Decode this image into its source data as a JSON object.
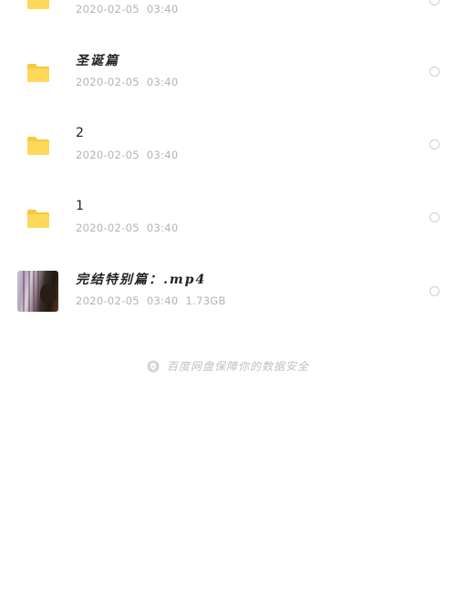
{
  "colors": {
    "folder": "#FDD85B",
    "folder_tab": "#F8C93C",
    "name_text": "#222222",
    "meta_text": "#B3B3B3",
    "radio_border": "#CFCFCF",
    "footer_text": "#C0C0C0"
  },
  "files": [
    {
      "type": "folder",
      "icon": "folder-icon",
      "name": "",
      "date": "2020-02-05",
      "time": "03:40",
      "size": ""
    },
    {
      "type": "folder",
      "icon": "folder-icon",
      "name": "圣诞篇",
      "date": "2020-02-05",
      "time": "03:40",
      "size": ""
    },
    {
      "type": "folder",
      "icon": "folder-icon",
      "name": "2",
      "date": "2020-02-05",
      "time": "03:40",
      "size": ""
    },
    {
      "type": "folder",
      "icon": "folder-icon",
      "name": "1",
      "date": "2020-02-05",
      "time": "03:40",
      "size": ""
    },
    {
      "type": "video",
      "icon": "video-thumbnail",
      "name": "完结特别篇：.mp4",
      "date": "2020-02-05",
      "time": "03:40",
      "size": "1.73GB"
    }
  ],
  "footer": {
    "icon": "shield-icon",
    "text": "百度网盘保障你的数据安全"
  }
}
